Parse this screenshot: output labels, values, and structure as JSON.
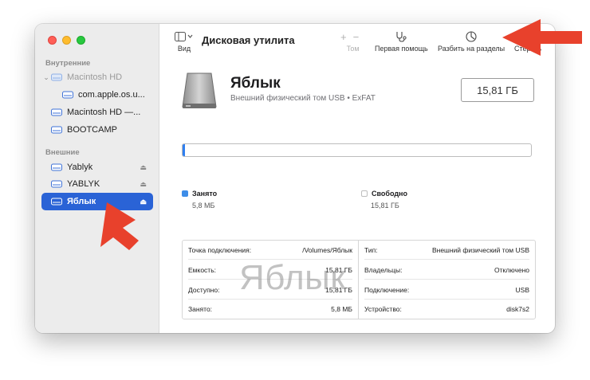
{
  "toolbar": {
    "view_label": "Вид",
    "title": "Дисковая утилита",
    "volume_label": "Том",
    "first_aid_label": "Первая помощь",
    "partition_label": "Разбить на разделы",
    "erase_label": "Стереть"
  },
  "sidebar": {
    "internal_header": "Внутренние",
    "external_header": "Внешние",
    "internal_items": [
      {
        "label": "Macintosh HD"
      },
      {
        "label": "com.apple.os.u..."
      },
      {
        "label": "Macintosh HD —..."
      },
      {
        "label": "BOOTCAMP"
      }
    ],
    "external_items": [
      {
        "label": "Yablyk"
      },
      {
        "label": "YABLYK"
      },
      {
        "label": "Яблык"
      }
    ]
  },
  "volume": {
    "name": "Яблык",
    "subtitle": "Внешний физический том USB • ExFAT",
    "size": "15,81 ГБ"
  },
  "usage": {
    "used_fraction": 0.0004,
    "used_label": "Занято",
    "used_value": "5,8 МБ",
    "free_label": "Свободно",
    "free_value": "15,81 ГБ",
    "used_color": "#2f7ff0"
  },
  "info": {
    "left": [
      {
        "key": "Точка подключения:",
        "value": "/Volumes/Яблык"
      },
      {
        "key": "Емкость:",
        "value": "15,81 ГБ"
      },
      {
        "key": "Доступно:",
        "value": "15,81 ГБ"
      },
      {
        "key": "Занято:",
        "value": "5,8 МБ"
      }
    ],
    "right": [
      {
        "key": "Тип:",
        "value": "Внешний физический том USB"
      },
      {
        "key": "Владельцы:",
        "value": "Отключено"
      },
      {
        "key": "Подключение:",
        "value": "USB"
      },
      {
        "key": "Устройство:",
        "value": "disk7s2"
      }
    ]
  },
  "watermark": "Яблык",
  "colors": {
    "accent": "#2a63d6",
    "arrow": "#e8412c"
  }
}
